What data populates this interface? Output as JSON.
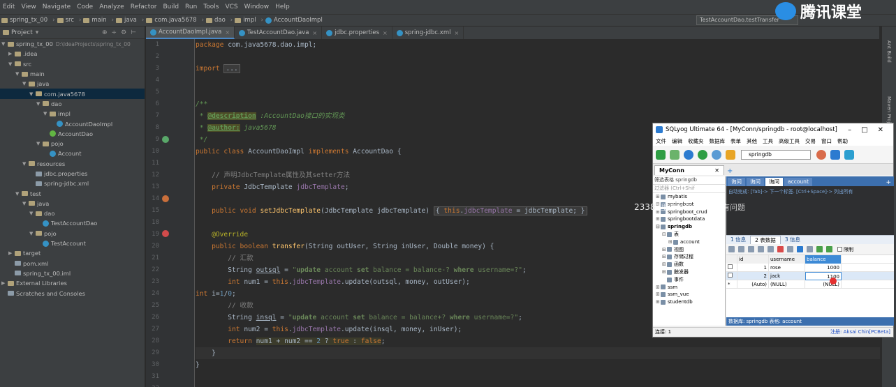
{
  "menu": [
    "Edit",
    "View",
    "Navigate",
    "Code",
    "Analyze",
    "Refactor",
    "Build",
    "Run",
    "Tools",
    "VCS",
    "Window",
    "Help"
  ],
  "breadcrumb": [
    "spring_tx_00",
    "src",
    "main",
    "java",
    "com.java5678",
    "dao",
    "impl",
    "AccountDaoImpl"
  ],
  "run_config": "TestAccountDao.testTransfer",
  "watermark": "腾讯课堂",
  "project": {
    "label": "Project",
    "tree": [
      {
        "text": "spring_tx_00",
        "extra": "D:\\IdeaProjects\\spring_tx_00",
        "indent": 0,
        "arrow": "▼",
        "icon": "folder"
      },
      {
        "text": ".idea",
        "indent": 1,
        "arrow": "▶",
        "icon": "folder"
      },
      {
        "text": "src",
        "indent": 1,
        "arrow": "▼",
        "icon": "folder"
      },
      {
        "text": "main",
        "indent": 2,
        "arrow": "▼",
        "icon": "folder"
      },
      {
        "text": "java",
        "indent": 3,
        "arrow": "▼",
        "icon": "folder"
      },
      {
        "text": "com.java5678",
        "indent": 4,
        "arrow": "▼",
        "icon": "folder",
        "selected": true
      },
      {
        "text": "dao",
        "indent": 5,
        "arrow": "▼",
        "icon": "folder"
      },
      {
        "text": "impl",
        "indent": 6,
        "arrow": "▼",
        "icon": "folder"
      },
      {
        "text": "AccountDaoImpl",
        "indent": 7,
        "arrow": "",
        "icon": "class"
      },
      {
        "text": "AccountDao",
        "indent": 6,
        "arrow": "",
        "icon": "interface"
      },
      {
        "text": "pojo",
        "indent": 5,
        "arrow": "▼",
        "icon": "folder"
      },
      {
        "text": "Account",
        "indent": 6,
        "arrow": "",
        "icon": "class"
      },
      {
        "text": "resources",
        "indent": 3,
        "arrow": "▼",
        "icon": "folder"
      },
      {
        "text": "jdbc.properties",
        "indent": 4,
        "arrow": "",
        "icon": "file"
      },
      {
        "text": "spring-jdbc.xml",
        "indent": 4,
        "arrow": "",
        "icon": "file"
      },
      {
        "text": "test",
        "indent": 2,
        "arrow": "▼",
        "icon": "folder"
      },
      {
        "text": "java",
        "indent": 3,
        "arrow": "▼",
        "icon": "folder"
      },
      {
        "text": "dao",
        "indent": 4,
        "arrow": "▼",
        "icon": "folder"
      },
      {
        "text": "TestAccountDao",
        "indent": 5,
        "arrow": "",
        "icon": "class"
      },
      {
        "text": "pojo",
        "indent": 4,
        "arrow": "▼",
        "icon": "folder"
      },
      {
        "text": "TestAccount",
        "indent": 5,
        "arrow": "",
        "icon": "class"
      },
      {
        "text": "target",
        "indent": 1,
        "arrow": "▶",
        "icon": "folder"
      },
      {
        "text": "pom.xml",
        "indent": 1,
        "arrow": "",
        "icon": "file"
      },
      {
        "text": "spring_tx_00.iml",
        "indent": 1,
        "arrow": "",
        "icon": "file"
      },
      {
        "text": "External Libraries",
        "indent": 0,
        "arrow": "▶",
        "icon": "folder"
      },
      {
        "text": "Scratches and Consoles",
        "indent": 0,
        "arrow": "",
        "icon": "file"
      }
    ]
  },
  "editor_tabs": [
    {
      "label": "AccountDaoImpl.java",
      "active": true
    },
    {
      "label": "TestAccountDao.java",
      "active": false
    },
    {
      "label": "jdbc.properties",
      "active": false
    },
    {
      "label": "spring-jdbc.xml",
      "active": false
    }
  ],
  "code_lines": [
    {
      "n": "1",
      "html": "<span class='kw'>package</span> com.java5678.dao.impl;"
    },
    {
      "n": "2",
      "html": ""
    },
    {
      "n": "3",
      "html": "<span class='kw'>import</span> <span class='fold'>...</span>"
    },
    {
      "n": "4",
      "html": ""
    },
    {
      "n": "5",
      "html": ""
    },
    {
      "n": "6",
      "html": "<span class='doc'>/**</span>"
    },
    {
      "n": "7",
      "html": "<span class='doc'> * </span><span class='doctag'>@description</span><span class='doc'> :AccountDao接口的实现类</span>"
    },
    {
      "n": "8",
      "html": "<span class='doc'> * </span><span class='doctag'>@author:</span><span class='doc'> java5678</span>"
    },
    {
      "n": "9",
      "html": "<span class='doc'> */</span>"
    },
    {
      "n": "10",
      "html": "<span class='kw'>public class</span> AccountDaoImpl <span class='kw'>implements</span> AccountDao {"
    },
    {
      "n": "11",
      "html": ""
    },
    {
      "n": "12",
      "html": "    <span class='cm'>// 声明JdbcTemplate属性及其setter方法</span>"
    },
    {
      "n": "13",
      "html": "    <span class='kw'>private</span> JdbcTemplate <span class='field'>jdbcTemplate</span>;"
    },
    {
      "n": "14",
      "html": ""
    },
    {
      "n": "15",
      "html": "    <span class='kw'>public void</span> <span class='fn'>setJdbcTemplate</span>(JdbcTemplate jdbcTemplate) <span class='fold'>{ <span class='kw'>this</span>.<span class='field'>jdbcTemplate</span> = jdbcTemplate; }</span>"
    },
    {
      "n": "18",
      "html": ""
    },
    {
      "n": "19",
      "html": "    <span class='ann'>@Override</span>"
    },
    {
      "n": "20",
      "html": "    <span class='kw'>public boolean</span> <span class='fn'>transfer</span>(String outUser, String inUser, Double money) {"
    },
    {
      "n": "21",
      "html": "        <span class='cm'>// 汇款</span>"
    },
    {
      "n": "22",
      "html": "        String <span class='ulvar'>outsql</span> = <span class='str'>\"<b>update</b> account <b>set</b> balance = balance-? <b>where</b> username=?\"</span>;"
    },
    {
      "n": "23",
      "html": "        <span class='kw'>int</span> num1 = <span class='kw'>this</span>.<span class='field'>jdbcTemplate</span>.update(outsql, money, outUser);"
    },
    {
      "n": "24",
      "html": "<span class='kw'>int</span> i=<span class='num'>1</span>/<span class='num'>0</span>;"
    },
    {
      "n": "25",
      "html": "        <span class='cm'>// 收款</span>"
    },
    {
      "n": "26",
      "html": "        String <span class='ulvar'>insql</span> = <span class='str'>\"<b>update</b> account <b>set</b> balance = balance+? <b>where</b> username=?\"</span>;"
    },
    {
      "n": "27",
      "html": "        <span class='kw'>int</span> num2 = <span class='kw'>this</span>.<span class='field'>jdbcTemplate</span>.update(insql, money, inUser);"
    },
    {
      "n": "28",
      "html": "        <span class='kw'>return</span> <span class='hlmark'>num1 + num2 == <span class='num'>2</span> ? <span class='kw'>true</span> : <span class='kw'>false</span></span>;"
    },
    {
      "n": "29",
      "html": "    }",
      "hl": true
    },
    {
      "n": "30",
      "html": "}"
    },
    {
      "n": "31",
      "html": ""
    },
    {
      "n": "32",
      "html": ""
    }
  ],
  "right_strip": [
    "Ant Build",
    "Maven Projects"
  ],
  "overlay": {
    "number": "2338",
    "text": "这里的事务点现在还有问题"
  },
  "sqlyog": {
    "title": "SQLyog Ultimate 64 - [MyConn/springdb - root@localhost]",
    "menu": [
      "文件",
      "编辑",
      "收藏夹",
      "数据库",
      "表单",
      "其他",
      "工具",
      "高级工具",
      "交易",
      "窗口",
      "帮助"
    ],
    "db_selected": "springdb",
    "conn_tab": "MyConn",
    "filter_label": "筛选表格 springdb",
    "filter_placeholder": "过滤器 (Ctrl+Shif",
    "databases": [
      {
        "text": "mybatis",
        "pm": "⊞",
        "indent": 0
      },
      {
        "text": "springboot",
        "pm": "⊞",
        "indent": 0
      },
      {
        "text": "springboot_crud",
        "pm": "⊞",
        "indent": 0
      },
      {
        "text": "springbootdata",
        "pm": "⊞",
        "indent": 0
      },
      {
        "text": "springdb",
        "pm": "⊟",
        "indent": 0,
        "bold": true
      },
      {
        "text": "表",
        "pm": "⊟",
        "indent": 1
      },
      {
        "text": "account",
        "pm": "⊞",
        "indent": 2
      },
      {
        "text": "视图",
        "pm": "⊞",
        "indent": 1
      },
      {
        "text": "存储过程",
        "pm": "⊞",
        "indent": 1
      },
      {
        "text": "函数",
        "pm": "⊞",
        "indent": 1
      },
      {
        "text": "触发器",
        "pm": "⊞",
        "indent": 1
      },
      {
        "text": "事件",
        "pm": "",
        "indent": 1
      },
      {
        "text": "ssm",
        "pm": "⊞",
        "indent": 0
      },
      {
        "text": "ssm_vue",
        "pm": "⊞",
        "indent": 0
      },
      {
        "text": "studentdb",
        "pm": "⊞",
        "indent": 0
      }
    ],
    "query_tabs": [
      {
        "label": "询问",
        "active": false
      },
      {
        "label": "询问",
        "active": false
      },
      {
        "label": "询问",
        "active": true
      },
      {
        "label": "account",
        "active": false
      }
    ],
    "hint": "自动完成: [Tab]-> 下一个标签. [Ctrl+Space]-> 列出所有",
    "result_tabs": [
      {
        "label": "1 信息",
        "active": false
      },
      {
        "label": "2 表数据",
        "active": true
      },
      {
        "label": "3 信息",
        "active": false
      }
    ],
    "toolbar_checkbox": "限制",
    "columns": [
      "id",
      "username",
      "balance"
    ],
    "rows": [
      {
        "id": "1",
        "username": "rose",
        "balance": "1000"
      },
      {
        "id": "2",
        "username": "jack",
        "balance": "1100"
      },
      {
        "id": "(Auto)",
        "username": "(NULL)",
        "balance": "(NULL)"
      }
    ],
    "status_db": "数据库: springdb  表格: account",
    "status_left": "连接: 1",
    "status_right": "注册: Aksai Chin[PCBeta]"
  }
}
